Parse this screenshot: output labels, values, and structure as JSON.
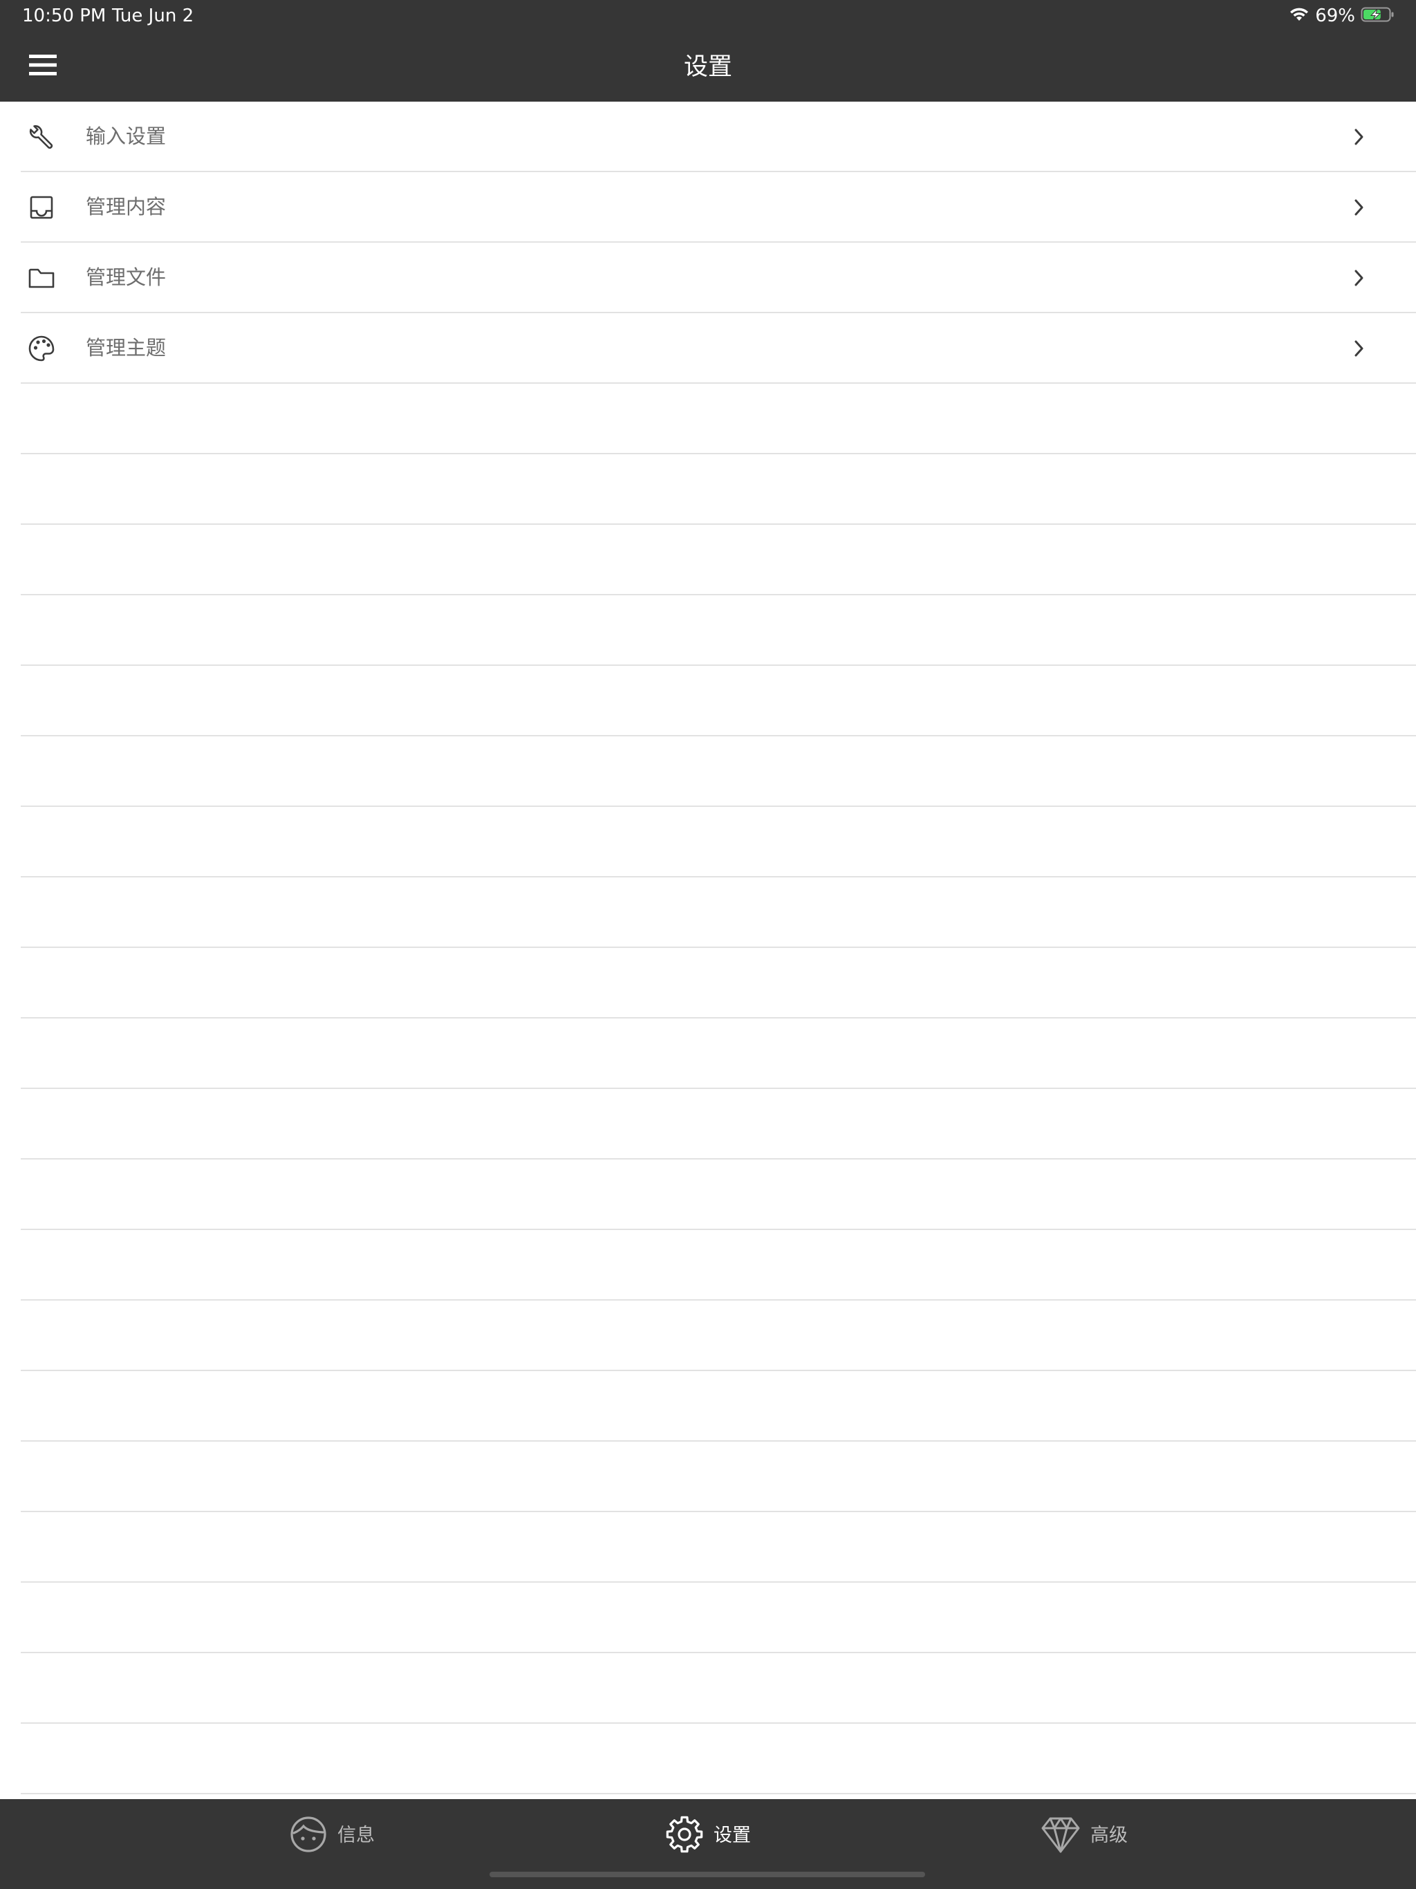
{
  "status_bar": {
    "time": "10:50 PM",
    "date": "Tue Jun 2",
    "battery_percent": "69%",
    "battery_level": 0.69,
    "wifi_icon": "wifi-icon",
    "battery_icon": "battery-charging-icon"
  },
  "nav": {
    "title": "设置",
    "menu_icon": "hamburger-menu-icon"
  },
  "settings_items": [
    {
      "label": "输入设置",
      "icon": "wrench-icon"
    },
    {
      "label": "管理内容",
      "icon": "inbox-tray-icon"
    },
    {
      "label": "管理文件",
      "icon": "folder-icon"
    },
    {
      "label": "管理主题",
      "icon": "palette-icon"
    }
  ],
  "tabs": [
    {
      "label": "信息",
      "icon": "face-icon",
      "active": false
    },
    {
      "label": "设置",
      "icon": "gear-icon",
      "active": true
    },
    {
      "label": "高级",
      "icon": "diamond-icon",
      "active": false
    }
  ],
  "colors": {
    "bar_background": "#363636",
    "list_background": "#ffffff",
    "separator": "#e2e2e2",
    "item_text": "#6e6e6e",
    "battery_fill": "#4cd964"
  }
}
